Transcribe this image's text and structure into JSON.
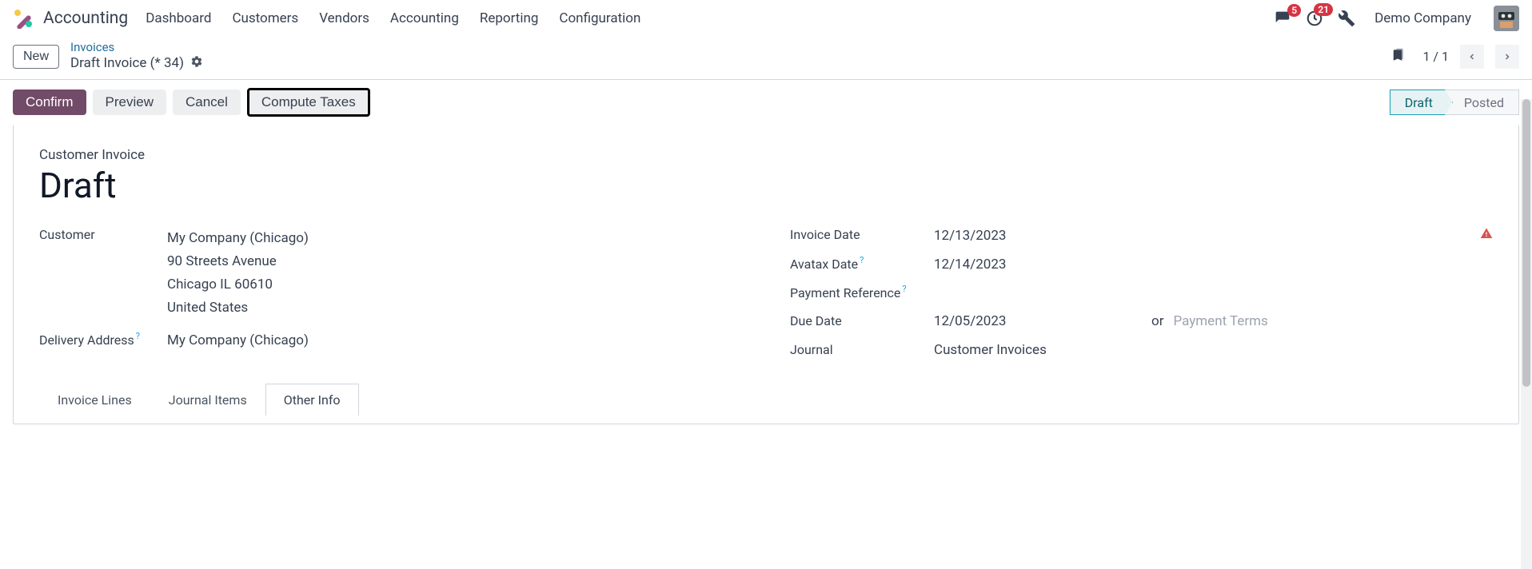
{
  "nav": {
    "app": "Accounting",
    "items": [
      "Dashboard",
      "Customers",
      "Vendors",
      "Accounting",
      "Reporting",
      "Configuration"
    ],
    "messages_badge": "5",
    "activities_badge": "21",
    "company": "Demo Company"
  },
  "breadcrumb": {
    "new_label": "New",
    "parent": "Invoices",
    "current": "Draft Invoice (* 34)"
  },
  "pager": {
    "text": "1 / 1"
  },
  "actions": {
    "confirm": "Confirm",
    "preview": "Preview",
    "cancel": "Cancel",
    "compute_taxes": "Compute Taxes"
  },
  "status": {
    "draft": "Draft",
    "posted": "Posted"
  },
  "form": {
    "doc_label": "Customer Invoice",
    "doc_title": "Draft",
    "left": {
      "customer_label": "Customer",
      "customer_name": "My Company (Chicago)",
      "customer_addr1": "90 Streets Avenue",
      "customer_addr2": "Chicago IL 60610",
      "customer_country": "United States",
      "delivery_label": "Delivery Address",
      "delivery_value": "My Company (Chicago)"
    },
    "right": {
      "invoice_date_label": "Invoice Date",
      "invoice_date": "12/13/2023",
      "avatax_date_label": "Avatax Date",
      "avatax_date": "12/14/2023",
      "payment_ref_label": "Payment Reference",
      "payment_ref": "",
      "due_date_label": "Due Date",
      "due_date": "12/05/2023",
      "due_or": "or",
      "payment_terms_placeholder": "Payment Terms",
      "journal_label": "Journal",
      "journal_value": "Customer Invoices"
    }
  },
  "tabs": {
    "items": [
      "Invoice Lines",
      "Journal Items",
      "Other Info"
    ]
  }
}
